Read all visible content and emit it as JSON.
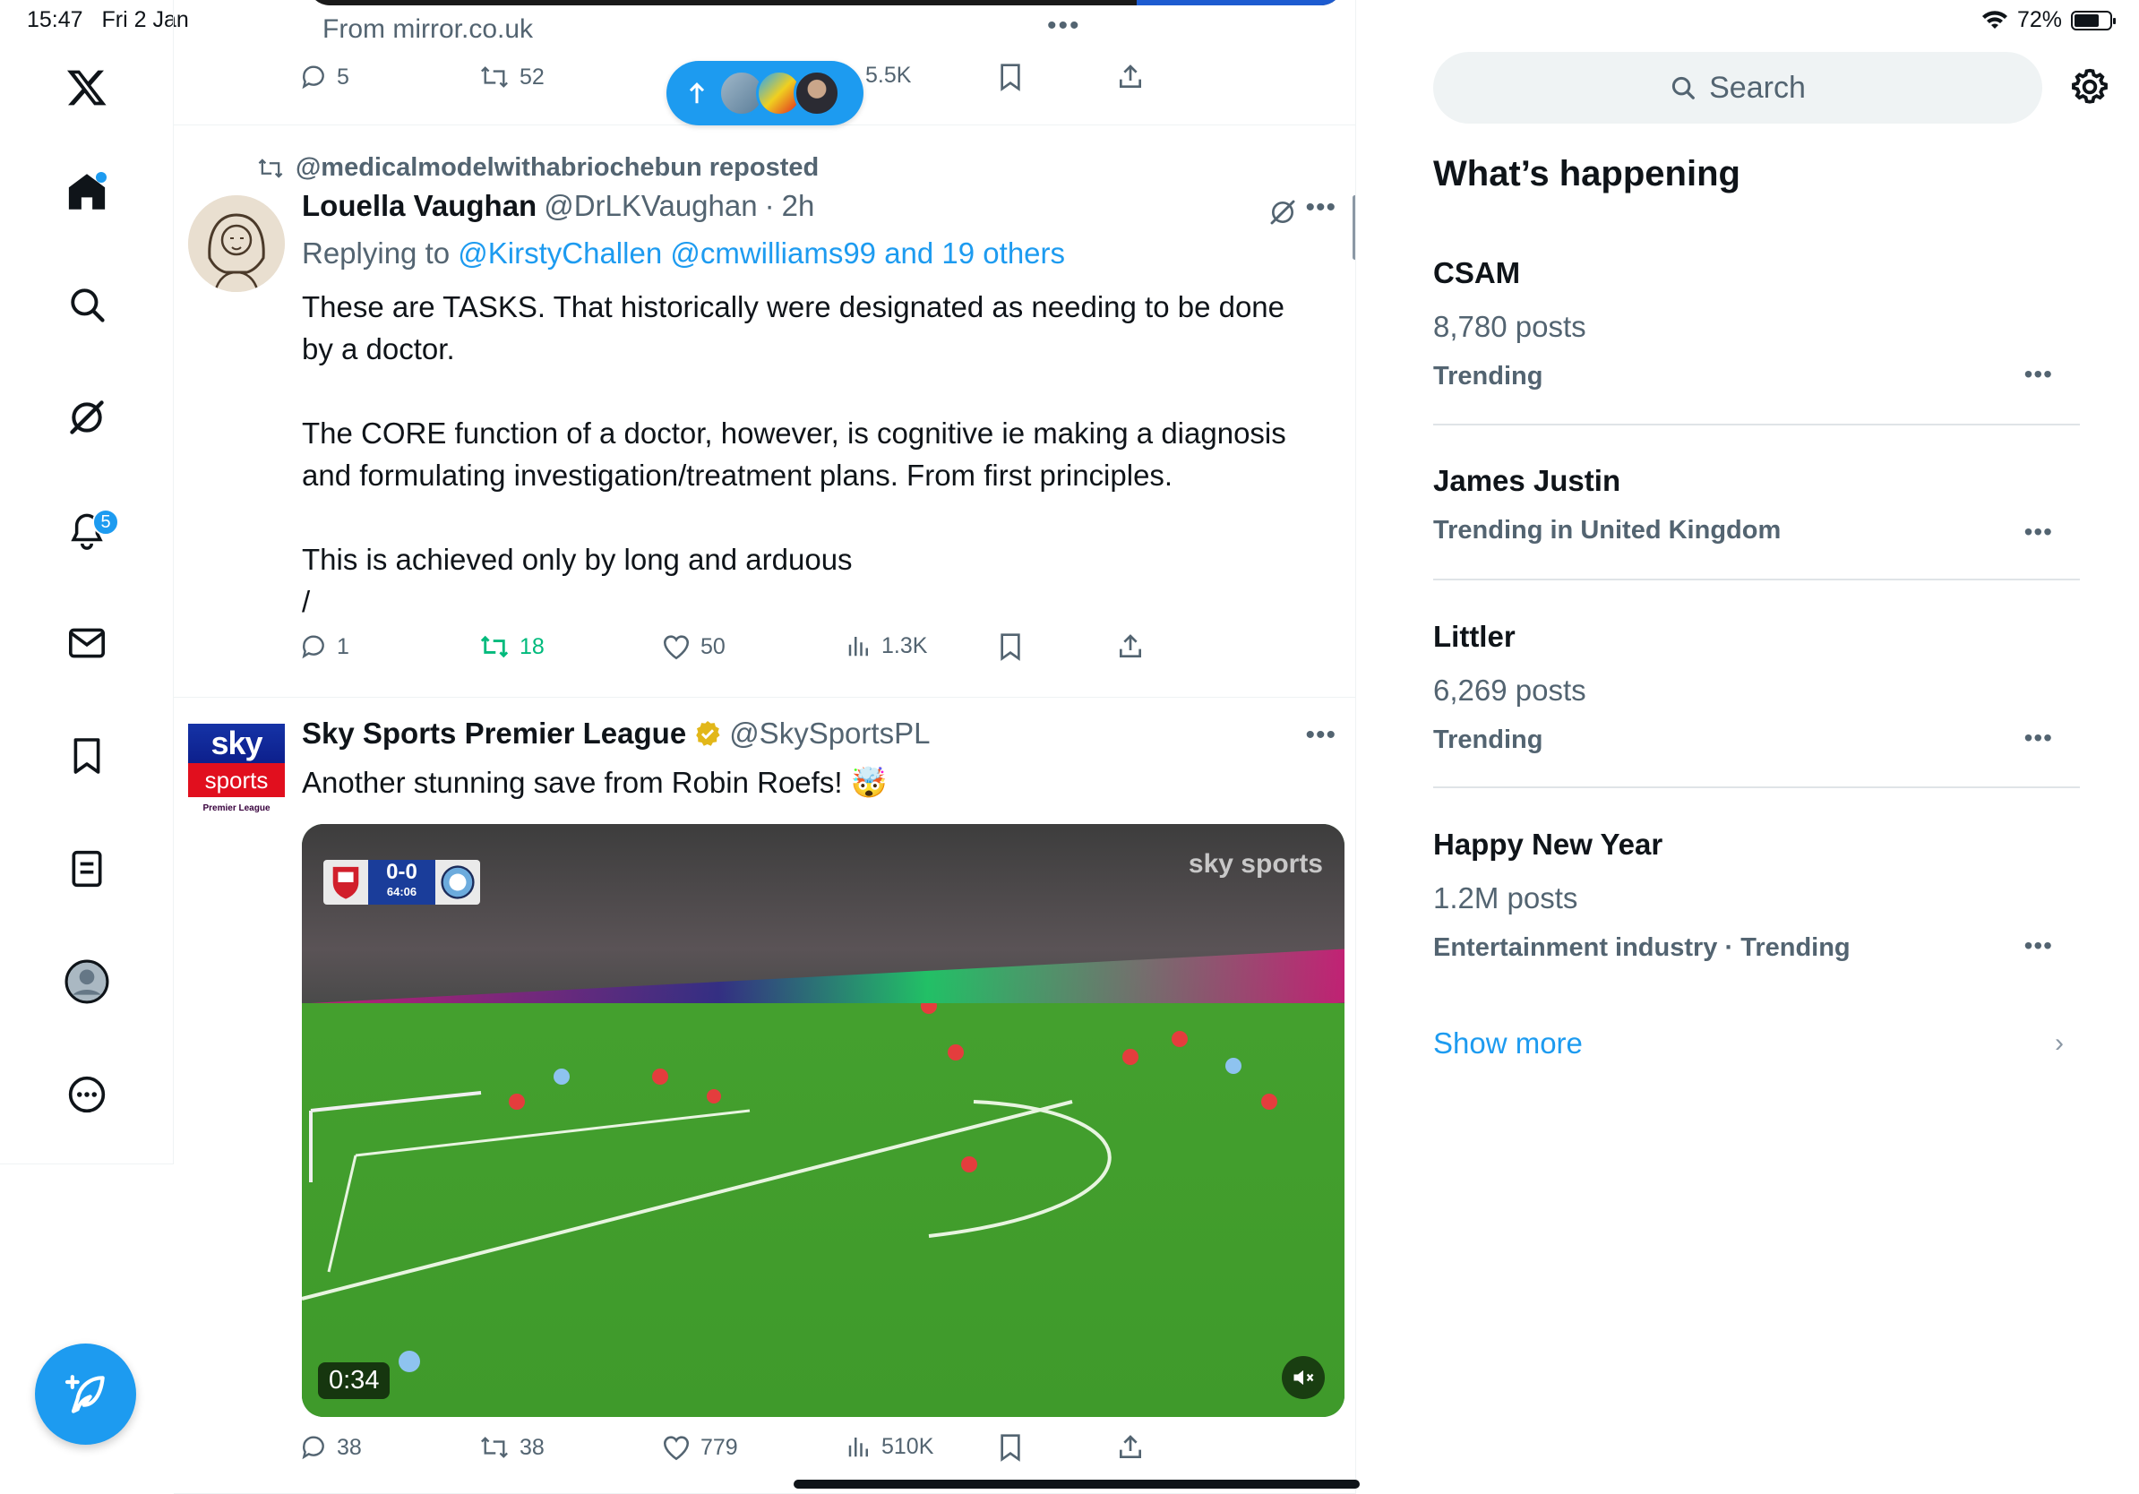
{
  "status_bar": {
    "time": "15:47",
    "date": "Fri 2 Jan",
    "battery": "72%"
  },
  "nav": {
    "notifications_count": "5",
    "items": [
      "home-icon",
      "search-icon",
      "grok-icon",
      "bell-icon",
      "mail-icon",
      "bookmark-icon",
      "lists-icon",
      "profile-icon",
      "more-icon"
    ]
  },
  "prev_tweet": {
    "source": "From mirror.co.uk",
    "replies": "5",
    "reposts": "52",
    "views": "5.5K"
  },
  "tweet1": {
    "repost_label": "@medicalmodelwithabriochebun reposted",
    "name": "Louella Vaughan",
    "handle": "@DrLKVaughan",
    "time": "2h",
    "replying_prefix": "Replying to ",
    "replying_to": "@KirstyChallen @cmwilliams99 and 19 others",
    "text": "These are TASKS. That historically were designated as needing to be done by a doctor.\n\nThe CORE function of a doctor, however, is cognitive ie making a diagnosis and formulating investigation/treatment plans. From first principles.\n\nThis is achieved only by long and arduous\n/",
    "replies": "1",
    "reposts": "18",
    "likes": "50",
    "views": "1.3K"
  },
  "tweet2": {
    "name": "Sky Sports Premier League",
    "handle": "@SkySportsPL",
    "text": "Another stunning save from Robin Roefs! 🤯",
    "logo_top": "sky",
    "logo_mid": "sports",
    "logo_bottom": "Premier League",
    "video": {
      "score": "0-0",
      "clock": "64:06",
      "watermark": "sky sports",
      "duration": "0:34"
    },
    "replies": "38",
    "reposts": "38",
    "likes": "779",
    "views": "510K"
  },
  "sidebar": {
    "search_placeholder": "Search",
    "title": "What’s happening",
    "trends": [
      {
        "name": "CSAM",
        "posts": "8,780 posts",
        "context": "Trending"
      },
      {
        "name": "James Justin",
        "posts": "",
        "context": "Trending in United Kingdom"
      },
      {
        "name": "Littler",
        "posts": "6,269 posts",
        "context": "Trending"
      },
      {
        "name": "Happy New Year",
        "posts": "1.2M posts",
        "context": "Entertainment industry · Trending"
      }
    ],
    "show_more": "Show more"
  },
  "colors": {
    "accent": "#1d9bf0",
    "repost_active": "#00ba7c",
    "secondary_text": "#536471"
  }
}
